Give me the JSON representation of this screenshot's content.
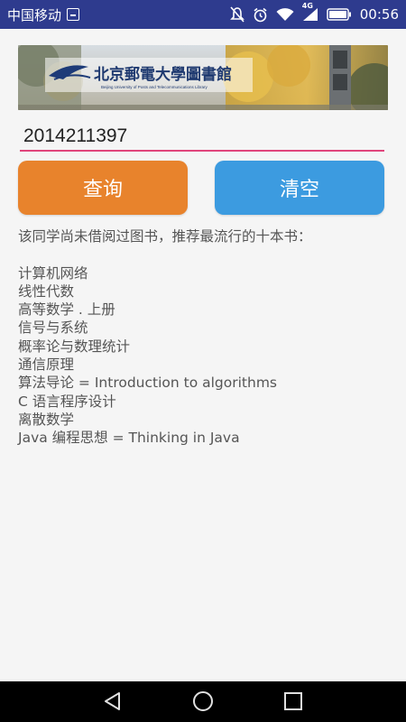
{
  "status_bar": {
    "carrier": "中国移动",
    "network": "4G",
    "time": "00:56"
  },
  "banner": {
    "title": "北京郵電大學圖書館",
    "subtitle": "Beijing University of Posts and Telecommunications Library"
  },
  "form": {
    "student_id": "2014211397",
    "query_label": "查询",
    "clear_label": "清空"
  },
  "result": {
    "message": "该同学尚未借阅过图书，推荐最流行的十本书：",
    "books": [
      "计算机网络",
      "线性代数",
      "高等数学 . 上册",
      "信号与系统",
      "概率论与数理统计",
      "通信原理",
      "算法导论 = Introduction to algorithms",
      "C 语言程序设计",
      "离散数学",
      "Java 编程思想 = Thinking in Java"
    ]
  },
  "colors": {
    "status_bar": "#2e3b8e",
    "query_button": "#e8832c",
    "clear_button": "#3c9be0",
    "input_underline": "#e0457b"
  }
}
